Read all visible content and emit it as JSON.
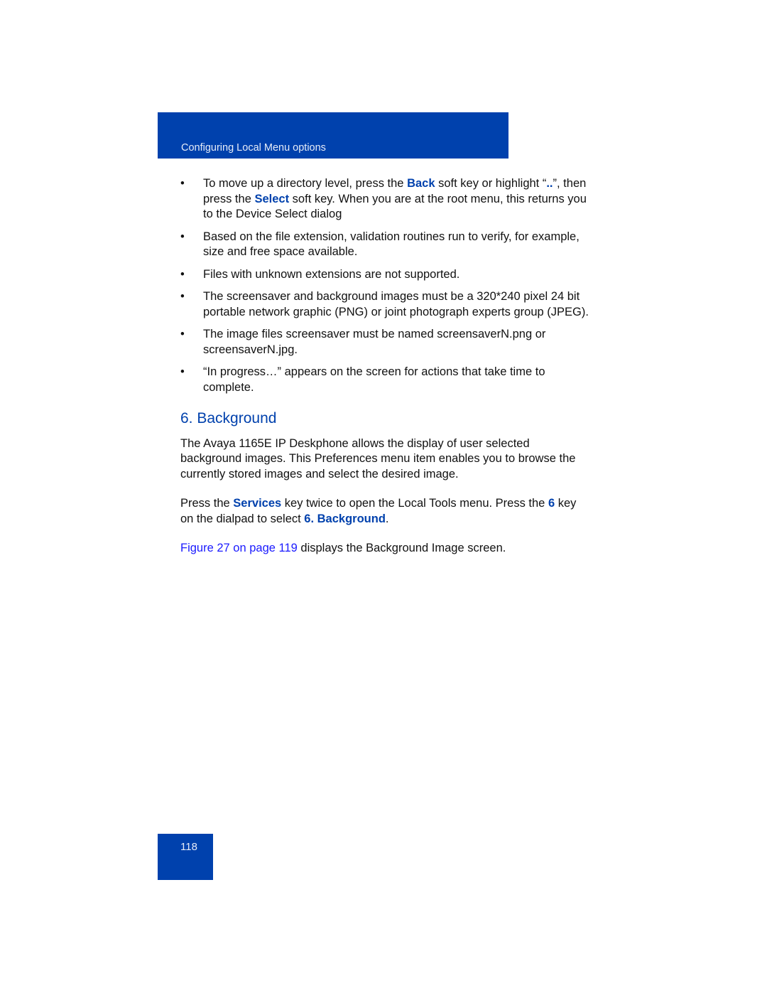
{
  "header": {
    "section_title": "Configuring Local Menu options"
  },
  "bullets": [
    {
      "parts": [
        "To move up a directory level, press the ",
        "Back",
        " soft key or highlight “",
        "..",
        "”, then press the ",
        "Select",
        " soft key. When you are at the root menu, this returns you to the Device Select dialog"
      ]
    },
    {
      "text": "Based on the file extension, validation routines run to verify, for example, size and free space available."
    },
    {
      "text": "Files with unknown extensions are not supported."
    },
    {
      "text": "The screensaver and background images must be a 320*240 pixel 24 bit portable network graphic (PNG) or joint photograph experts group (JPEG)."
    },
    {
      "text": "The image files screensaver must be named screensaverN.png or screensaverN.jpg."
    },
    {
      "text": "“In progress…” appears on the screen for actions that take time to complete."
    }
  ],
  "bullet_glyph": "•",
  "section": {
    "heading": "6. Background"
  },
  "para1": "The Avaya 1165E IP Deskphone allows the display of user selected background images. This Preferences menu item enables you to browse the currently stored images and select the desired image.",
  "para2": {
    "p1": "Press the ",
    "k1": "Services",
    "p2": " key twice to open the Local Tools menu. Press the ",
    "k2": "6",
    "p3": " key on the dialpad to select ",
    "k3": "6. Background",
    "p4": "."
  },
  "para3": {
    "link": "Figure 27 on page 119",
    "rest": " displays the Background Image screen."
  },
  "footer": {
    "page_number": "118"
  }
}
